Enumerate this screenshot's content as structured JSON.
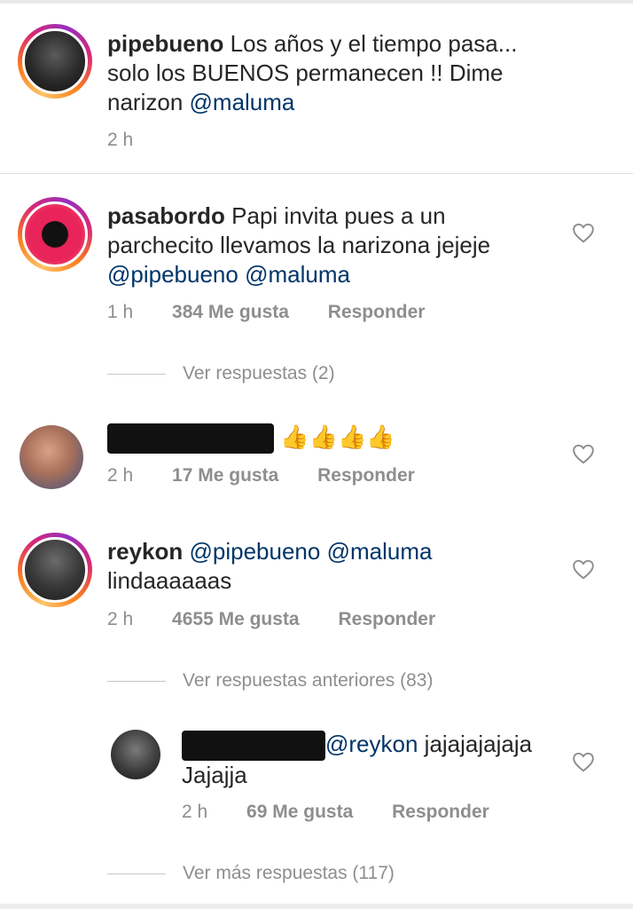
{
  "comments": [
    {
      "username": "pipebueno",
      "text": "Los años y el tiempo pasa... solo los BUENOS permanecen !! Dime narizon",
      "line1": "Los años y el tiempo pasa...",
      "line2": "solo los BUENOS permanecen !! Dime",
      "line3": "narizon",
      "mention": "@maluma",
      "time": "2 h"
    },
    {
      "username": "pasabordo",
      "line1": "Papi invita pues a un",
      "line2": "parchecito llevamos la narizona jejeje",
      "mention1": "@pipebueno",
      "mention2": "@maluma",
      "time": "1 h",
      "likes": "384 Me gusta",
      "reply": "Responder",
      "view_replies": "Ver respuestas (2)"
    },
    {
      "username": "",
      "text": "👍👍👍👍",
      "time": "2 h",
      "likes": "17 Me gusta",
      "reply": "Responder"
    },
    {
      "username": "reykon",
      "mention1": "@pipebueno",
      "mention2": "@maluma",
      "text": "lindaaaaaas",
      "time": "2 h",
      "likes": "4655 Me gusta",
      "reply": "Responder",
      "view_previous": "Ver respuestas anteriores (83)"
    },
    {
      "username": "",
      "mention": "@reykon",
      "text_inline": "jajajajajaja",
      "text_line2": "Jajajja",
      "time": "2 h",
      "likes": "69 Me gusta",
      "reply": "Responder",
      "view_more": "Ver más respuestas (117)"
    }
  ],
  "icons": {
    "like": "heart-outline-icon"
  },
  "colors": {
    "mention": "#003569",
    "meta": "#8e8e8e",
    "text": "#262626"
  }
}
